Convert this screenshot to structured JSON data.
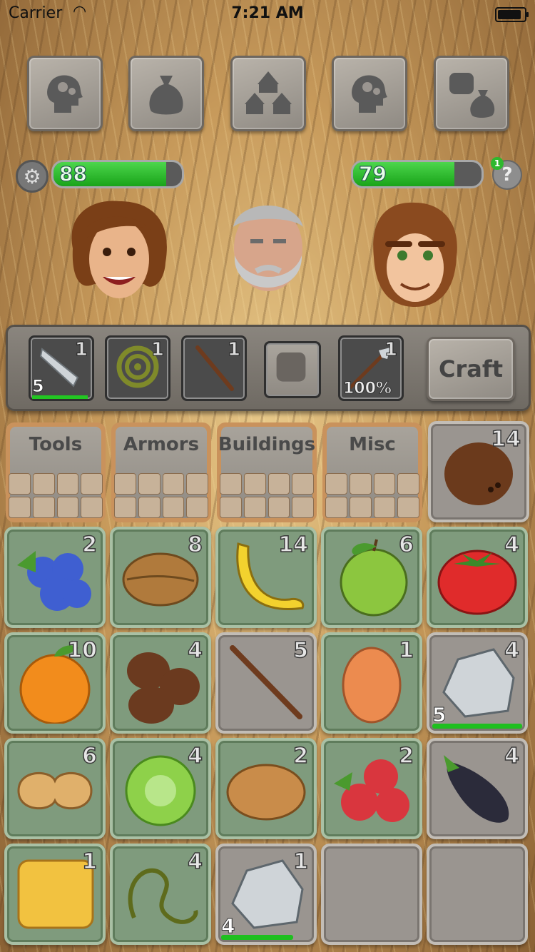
{
  "status_bar": {
    "carrier": "Carrier",
    "time": "7:21 AM",
    "battery_level": 0.95
  },
  "top_buttons": [
    {
      "name": "skills-button",
      "icon": "head-gears-icon"
    },
    {
      "name": "inventory-bag-button",
      "icon": "bag-icon"
    },
    {
      "name": "village-button",
      "icon": "huts-icon"
    },
    {
      "name": "skills-alt-button",
      "icon": "head-gears-icon"
    },
    {
      "name": "trade-button",
      "icon": "fist-bag-icon"
    }
  ],
  "stats": {
    "left": {
      "value": "88",
      "fill": 0.88
    },
    "right": {
      "value": "79",
      "fill": 0.79
    },
    "help_label": "?",
    "help_badge": "1"
  },
  "characters": [
    "young-caveman",
    "elder-caveman",
    "ape-caveman"
  ],
  "equipment": [
    {
      "item": "stone-spearhead",
      "count": "1",
      "durability": "5",
      "bar": 1.0
    },
    {
      "item": "vine-rope",
      "count": "1"
    },
    {
      "item": "stick",
      "count": "1"
    },
    {
      "item": "empty-fist",
      "count": ""
    },
    {
      "item": "spear",
      "count": "1",
      "percent": "100%"
    }
  ],
  "craft_label": "Craft",
  "categories": [
    {
      "label": "Tools"
    },
    {
      "label": "Armors"
    },
    {
      "label": "Buildings"
    },
    {
      "label": "Misc"
    }
  ],
  "inventory": [
    {
      "item": "coconut",
      "count": "14",
      "color": "#6b3a1c"
    },
    {
      "item": "blueberries",
      "count": "2",
      "color": "#3f5fd1"
    },
    {
      "item": "walnut",
      "count": "8",
      "color": "#b07a3c"
    },
    {
      "item": "banana",
      "count": "14",
      "color": "#f2d22e"
    },
    {
      "item": "green-apple",
      "count": "6",
      "color": "#8cc63f"
    },
    {
      "item": "tomato",
      "count": "4",
      "color": "#e02b2b"
    },
    {
      "item": "orange",
      "count": "10",
      "color": "#f28c1c"
    },
    {
      "item": "chestnuts",
      "count": "4",
      "color": "#6b3a1f"
    },
    {
      "item": "stick",
      "count": "5",
      "color": "#6e3b1e"
    },
    {
      "item": "egg",
      "count": "1",
      "color": "#ec8b4f"
    },
    {
      "item": "stone",
      "count": "4",
      "color": "#cfd4d8",
      "durability": "5",
      "bar": 1.0
    },
    {
      "item": "peanut",
      "count": "6",
      "color": "#e0b06b"
    },
    {
      "item": "lettuce",
      "count": "4",
      "color": "#8ed14a"
    },
    {
      "item": "potato",
      "count": "2",
      "color": "#c98c4a"
    },
    {
      "item": "raspberries",
      "count": "2",
      "color": "#d9363e"
    },
    {
      "item": "eggplant",
      "count": "4",
      "color": "#2b2b3a"
    },
    {
      "item": "honeycomb",
      "count": "1",
      "color": "#f2c240"
    },
    {
      "item": "vine",
      "count": "4",
      "color": "#5e6b1c"
    },
    {
      "item": "stone",
      "count": "1",
      "color": "#cfd4d8",
      "durability": "4",
      "bar": 0.8
    },
    {
      "item": "empty",
      "count": ""
    },
    {
      "item": "empty",
      "count": ""
    }
  ],
  "colors": {
    "health_green": "#19a319",
    "slot_green": "#7f9b7d",
    "slot_grey": "#9a9590"
  }
}
